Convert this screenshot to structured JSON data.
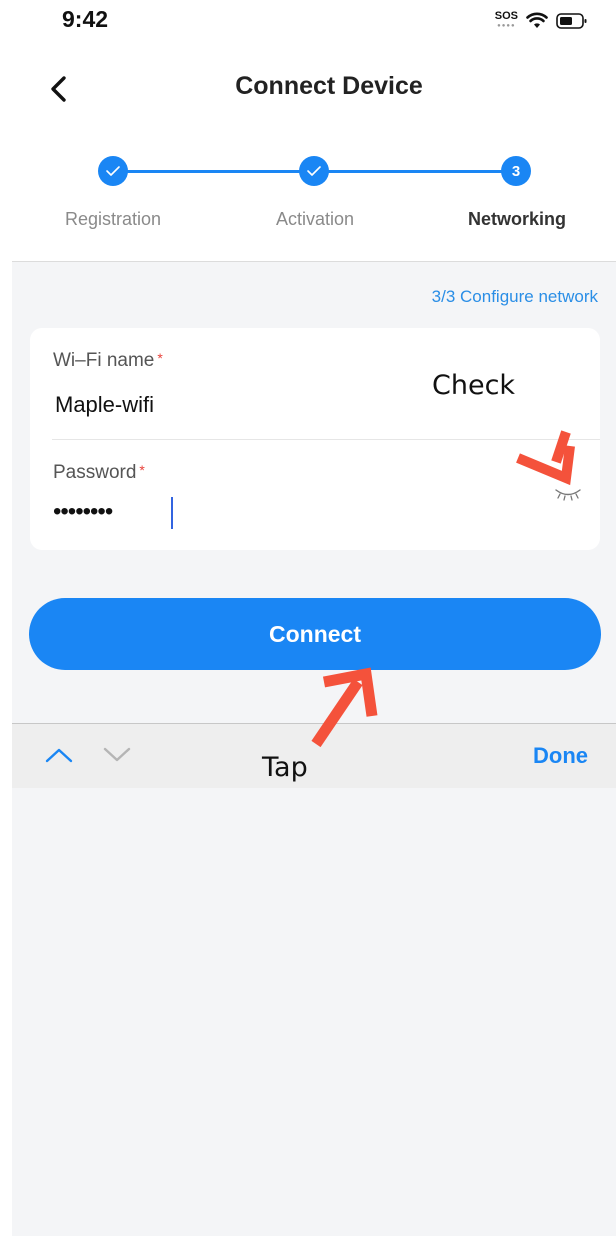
{
  "status_bar": {
    "time": "9:42",
    "sos": "SOS"
  },
  "header": {
    "title": "Connect Device",
    "back_icon": "chevron-left-icon"
  },
  "stepper": {
    "steps": [
      {
        "label": "Registration",
        "state": "done",
        "marker": "check-icon"
      },
      {
        "label": "Activation",
        "state": "done",
        "marker": "check-icon"
      },
      {
        "label": "Networking",
        "state": "current",
        "marker": "3"
      }
    ],
    "accent": "#1a86f4"
  },
  "form": {
    "progress_link": "3/3 Configure network",
    "wifi": {
      "label": "Wi–Fi name",
      "required_mark": "*",
      "value": "Maple-wifi"
    },
    "password": {
      "label": "Password",
      "required_mark": "*",
      "value": "••••••••",
      "visibility_icon": "eye-closed-icon"
    }
  },
  "connect_button": {
    "label": "Connect"
  },
  "keyboard_bar": {
    "prev_icon": "chevron-up-icon",
    "next_icon": "chevron-down-icon",
    "done_label": "Done"
  },
  "annotations": {
    "check": "Check",
    "tap": "Tap",
    "color": "#f4523b"
  },
  "colors": {
    "background": "#f4f5f7",
    "required": "#e8413a",
    "link": "#2a8ee6"
  }
}
